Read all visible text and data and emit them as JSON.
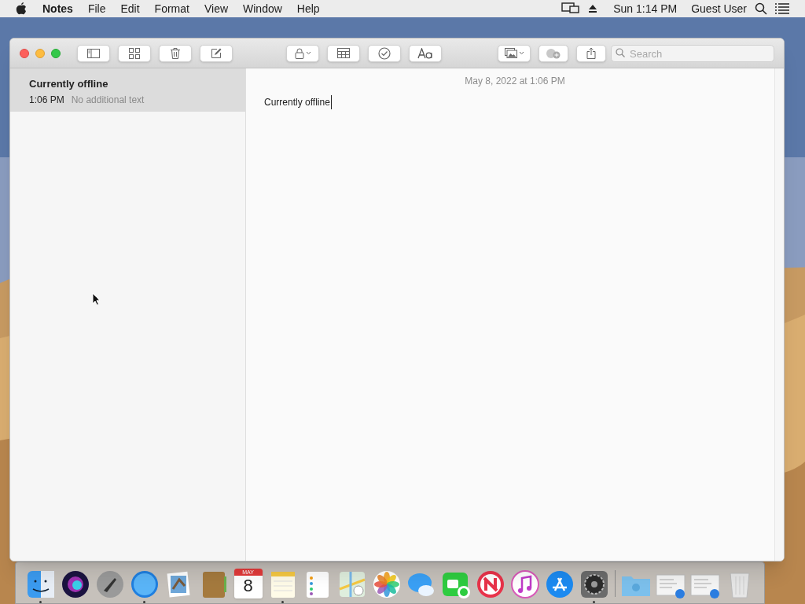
{
  "menu_bar": {
    "app_name": "Notes",
    "menus": [
      "File",
      "Edit",
      "Format",
      "View",
      "Window",
      "Help"
    ],
    "clock": "Sun 1:14 PM",
    "user": "Guest User"
  },
  "window": {
    "search": {
      "placeholder": "Search"
    },
    "notes": [
      {
        "title": "Currently offline",
        "time": "1:06 PM",
        "preview": "No additional text",
        "selected": true
      }
    ],
    "editor": {
      "date": "May 8, 2022 at 1:06 PM",
      "body": "Currently offline"
    }
  },
  "dock": {
    "items": [
      {
        "kind": "finder",
        "running": true
      },
      {
        "kind": "siri",
        "running": false
      },
      {
        "kind": "launchpad",
        "running": false
      },
      {
        "kind": "safari",
        "running": true
      },
      {
        "kind": "preview",
        "running": false
      },
      {
        "kind": "contacts",
        "running": false
      },
      {
        "kind": "calendar",
        "running": false,
        "month": "MAY",
        "day": "8"
      },
      {
        "kind": "notes",
        "running": true
      },
      {
        "kind": "reminders",
        "running": false
      },
      {
        "kind": "maps",
        "running": false
      },
      {
        "kind": "photos",
        "running": false
      },
      {
        "kind": "messages",
        "running": false
      },
      {
        "kind": "facetime",
        "running": false
      },
      {
        "kind": "news",
        "running": false
      },
      {
        "kind": "music",
        "running": false
      },
      {
        "kind": "appstore",
        "running": false
      },
      {
        "kind": "settings",
        "running": true
      },
      {
        "kind": "separator"
      },
      {
        "kind": "folder",
        "running": false
      },
      {
        "kind": "document",
        "running": false
      },
      {
        "kind": "document",
        "running": false
      },
      {
        "kind": "trash",
        "running": false
      }
    ]
  }
}
